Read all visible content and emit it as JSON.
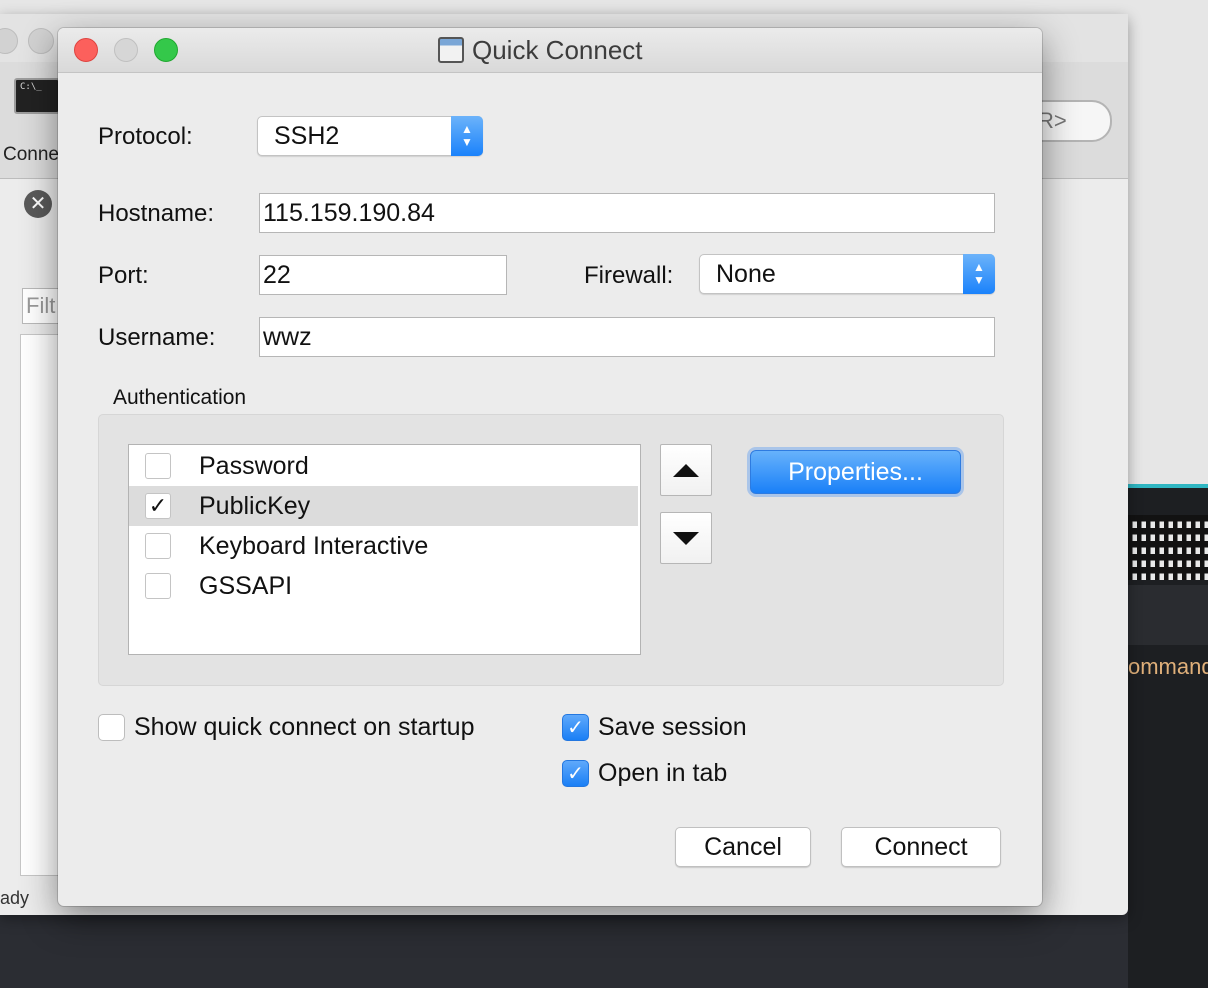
{
  "background": {
    "connect_icon_text": "C:\\_",
    "connect_label": "Conne",
    "search_pill_text": "R>",
    "filter_placeholder": "Filt",
    "status_text": "ady",
    "terminal_text": "ommand",
    "close_icon_glyph": "✕"
  },
  "dialog": {
    "title": "Quick Connect",
    "protocol": {
      "label": "Protocol:",
      "value": "SSH2"
    },
    "hostname": {
      "label": "Hostname:",
      "value": "115.159.190.84"
    },
    "port": {
      "label": "Port:",
      "value": "22"
    },
    "firewall": {
      "label": "Firewall:",
      "value": "None"
    },
    "username": {
      "label": "Username:",
      "value": "wwz"
    },
    "authentication": {
      "label": "Authentication",
      "methods": [
        {
          "name": "Password",
          "checked": false,
          "check_glyph": ""
        },
        {
          "name": "PublicKey",
          "checked": true,
          "check_glyph": "✓"
        },
        {
          "name": "Keyboard Interactive",
          "checked": false,
          "check_glyph": ""
        },
        {
          "name": "GSSAPI",
          "checked": false,
          "check_glyph": ""
        }
      ],
      "properties_label": "Properties..."
    },
    "options": {
      "show_on_startup": {
        "label": "Show quick connect on startup",
        "checked": false,
        "glyph": ""
      },
      "save_session": {
        "label": "Save session",
        "checked": true,
        "glyph": "✓"
      },
      "open_in_tab": {
        "label": "Open in tab",
        "checked": true,
        "glyph": "✓"
      }
    },
    "buttons": {
      "cancel": "Cancel",
      "connect": "Connect"
    }
  },
  "colors": {
    "accent": "#1a80f8",
    "close": "#fc605c",
    "zoom": "#34c84a"
  }
}
